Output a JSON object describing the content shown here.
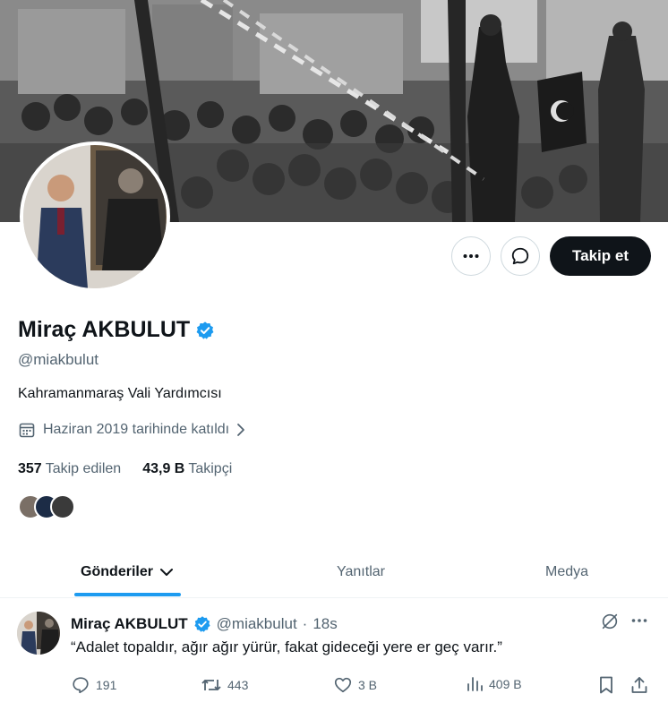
{
  "profile": {
    "name": "Miraç AKBULUT",
    "handle": "@miakbulut",
    "bio": "Kahramanmaraş Vali Yardımcısı",
    "joined": "Haziran 2019 tarihinde katıldı",
    "following_count": "357",
    "following_label": "Takip edilen",
    "followers_count": "43,9 B",
    "followers_label": "Takipçi",
    "verified_color": "#1d9bf0"
  },
  "actions": {
    "more_icon": "more-horizontal-icon",
    "message_icon": "message-bubble-icon",
    "follow_label": "Takip et"
  },
  "tabs": [
    {
      "label": "Gönderiler",
      "active": true
    },
    {
      "label": "Yanıtlar",
      "active": false
    },
    {
      "label": "Medya",
      "active": false
    }
  ],
  "tweet": {
    "name": "Miraç AKBULUT",
    "handle": "@miakbulut",
    "separator": "·",
    "time": "18s",
    "text": "“Adalet topaldır, ağır ağır yürür, fakat gideceği yere er geç varır.”",
    "replies": "191",
    "retweets": "443",
    "likes": "3 B",
    "views": "409 B"
  },
  "colors": {
    "accent": "#1d9bf0",
    "text_primary": "#0f1419",
    "text_secondary": "#536471",
    "follow_button_bg": "#0f1419"
  }
}
